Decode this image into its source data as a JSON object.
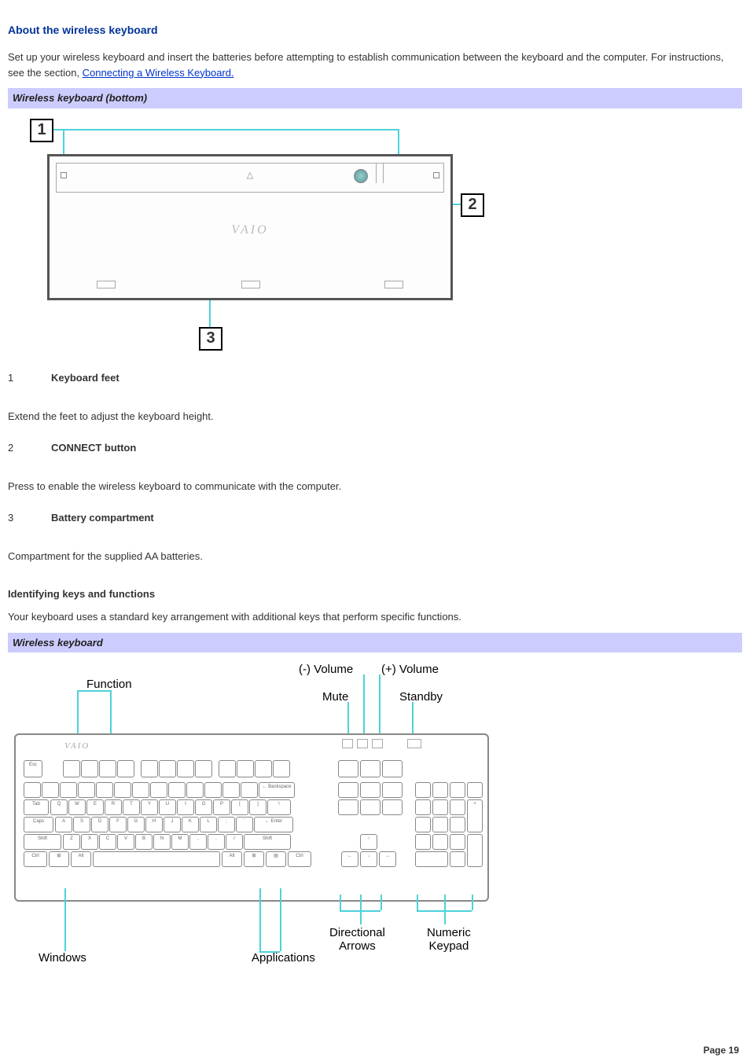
{
  "title": "About the wireless keyboard",
  "intro_part1": "Set up your wireless keyboard and insert the batteries before attempting to establish communication between the keyboard and the computer. For instructions, see the section, ",
  "intro_link": "Connecting a Wireless Keyboard.",
  "bar1": "Wireless keyboard (bottom)",
  "callouts": {
    "c1": "1",
    "c2": "2",
    "c3": "3"
  },
  "diagram1_brand": "VAIO",
  "definitions": [
    {
      "num": "1",
      "term": "Keyboard feet",
      "desc": "Extend the feet to adjust the keyboard height."
    },
    {
      "num": "2",
      "term": "CONNECT button",
      "desc": "Press to enable the wireless keyboard to communicate with the computer."
    },
    {
      "num": "3",
      "term": "Battery compartment",
      "desc": "Compartment for the supplied AA batteries."
    }
  ],
  "subhead": "Identifying keys and functions",
  "subdesc": "Your keyboard uses a standard key arrangement with additional keys that perform specific functions.",
  "bar2": "Wireless keyboard",
  "diagram2_labels": {
    "function": "Function",
    "vol_down": "(-) Volume",
    "vol_up": "(+) Volume",
    "mute": "Mute",
    "standby": "Standby",
    "directional": "Directional\nArrows",
    "numeric": "Numeric\nKeypad",
    "windows": "Windows",
    "applications": "Applications"
  },
  "diagram2_brand": "VAIO",
  "footer": "Page 19"
}
